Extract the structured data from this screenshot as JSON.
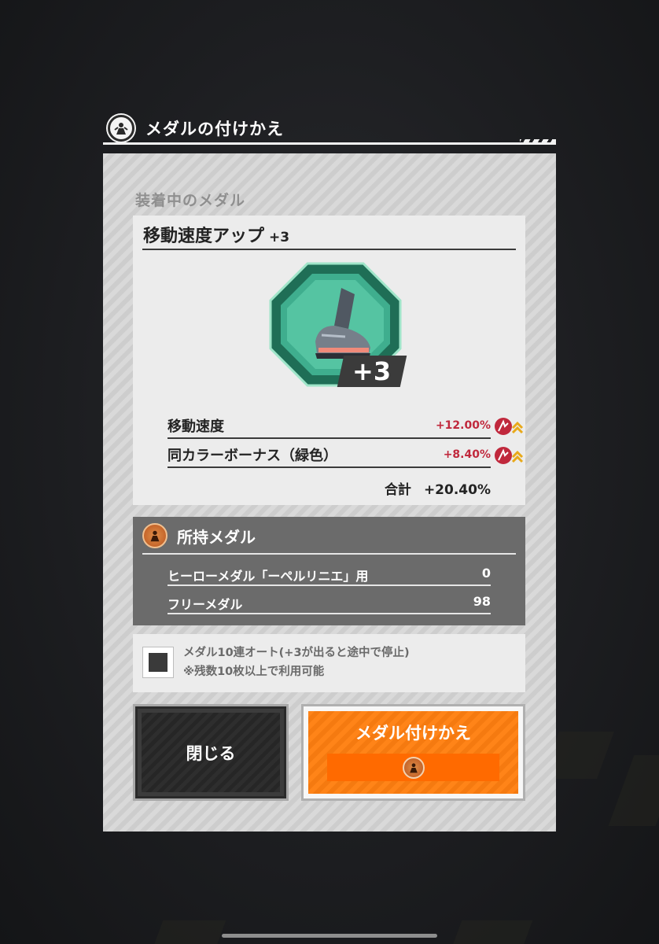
{
  "header": {
    "title": "メダルの付けかえ",
    "icon": "hero-emblem-icon"
  },
  "equipped": {
    "section_label": "装着中のメダル",
    "medal_name": "移動速度アップ",
    "medal_level": "+3",
    "medal_badge": "+3",
    "medal_icon": "boot-icon",
    "medal_color": "#3fae8e",
    "stats": [
      {
        "label": "移動速度",
        "value": "+12.00%"
      },
      {
        "label": "同カラーボーナス（緑色）",
        "value": "+8.40%"
      }
    ],
    "total_label": "合計",
    "total_value": "+20.40%"
  },
  "owned": {
    "title": "所持メダル",
    "rows": [
      {
        "label": "ヒーローメダル「ーペルリニエ」用",
        "value": "0"
      },
      {
        "label": "フリーメダル",
        "value": "98"
      }
    ]
  },
  "auto": {
    "line1": "メダル10連オート(+3が出ると途中で停止)",
    "line2": "※残数10枚以上で利用可能"
  },
  "buttons": {
    "close": "閉じる",
    "change": "メダル付けかえ"
  },
  "colors": {
    "accent_orange": "#ff8418",
    "stat_red": "#c0283c",
    "panel_gray": "#d9d9d9"
  }
}
